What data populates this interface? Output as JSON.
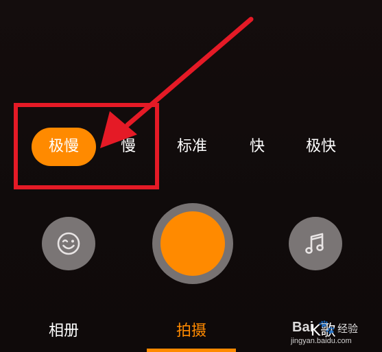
{
  "speed_options": [
    {
      "label": "极慢",
      "selected": true
    },
    {
      "label": "慢",
      "selected": false
    },
    {
      "label": "标准",
      "selected": false
    },
    {
      "label": "快",
      "selected": false
    },
    {
      "label": "极快",
      "selected": false
    }
  ],
  "controls": {
    "left_icon": "smiley-face-icon",
    "right_icon": "music-note-icon",
    "shutter_icon": "record-button"
  },
  "tabs": [
    {
      "label": "相册",
      "active": false
    },
    {
      "label": "拍摄",
      "active": true
    },
    {
      "label": "K歌",
      "active": false
    }
  ],
  "watermark": {
    "brand": "Bai",
    "paw": "🐾",
    "jingyan": "经验",
    "url": "jingyan.baidu.com"
  },
  "colors": {
    "accent": "#ff8a00",
    "annotation": "#e51a26",
    "button_gray": "#7a7575",
    "background": "#120c0c"
  }
}
